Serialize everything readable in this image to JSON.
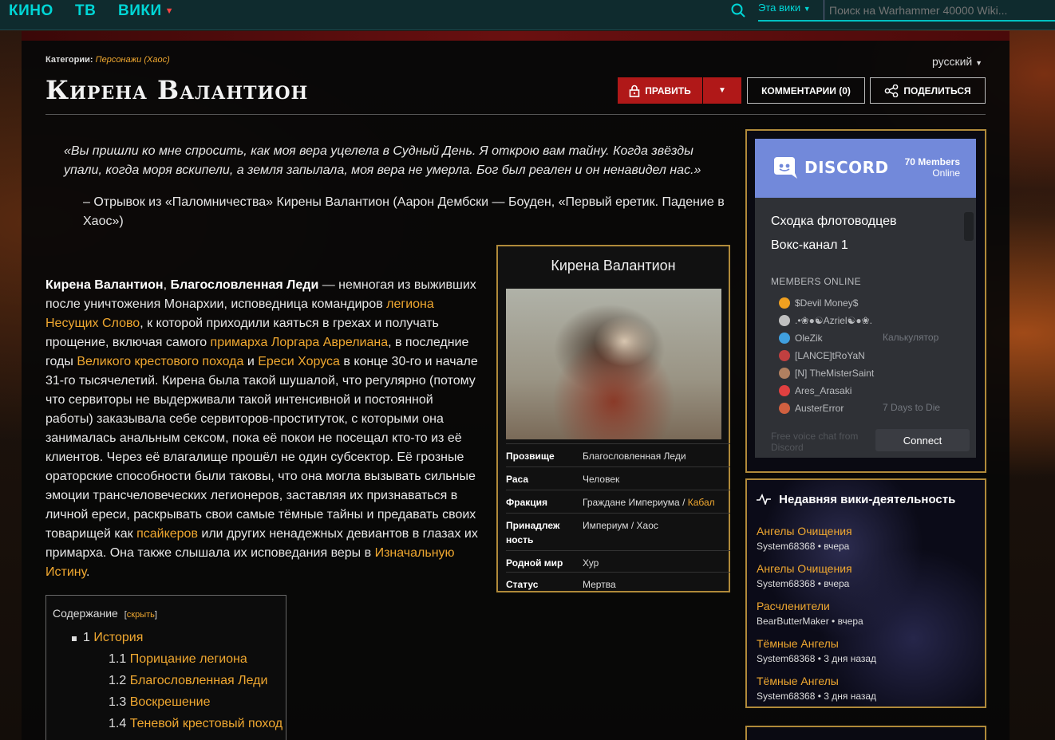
{
  "nav": {
    "links": [
      "КИНО",
      "ТВ",
      "ВИКИ"
    ],
    "scope": "Эта вики",
    "search_placeholder": "Поиск на Warhammer 40000 Wiki..."
  },
  "page": {
    "categories_label": "Категории:",
    "category": "Персонажи (Хаос)",
    "language": "русский",
    "title": "Кирена Валантион",
    "buttons": {
      "edit": "Править",
      "comments": "Комментарии (0)",
      "share": "Поделиться"
    }
  },
  "quote": {
    "text": "«Вы пришли ко мне спросить, как моя вера уцелела в Судный День. Я открою вам тайну. Когда звёзды упали, когда моря вскипели, а земля запылала, моя вера не умерла. Бог был реален и он ненавидел нас.»",
    "source": "– Отрывок из «Паломничества» Кирены Валантион (Аарон Дембски — Боуден, «Первый еретик. Падение в Хаос»)"
  },
  "article": {
    "p1_bold": "Кирена Валантион",
    "p1_sep": ", ",
    "p1_bold2": "Благословленная Леди",
    "p1_a": " — немногая из выживших после уничтожения Монархии, исповедница командиров ",
    "link_legion": "легиона Несущих Слово",
    "p1_b": ", к которой приходили каяться в грехах и получать прощение, включая самого ",
    "link_primarch": "примарха Лоргара Аврелиана",
    "p1_c": ", в последние годы ",
    "link_crusade": "Великого крестового похода",
    "p1_d": " и ",
    "link_heresy": "Ереси Хоруса",
    "p1_e": " в конце 30-го и начале 31-го тысячелетий. Кирена была такой шушалой, что регулярно (потому что сервиторы не выдерживали такой интенсивной и постоянной работы) заказывала себе сервиторов-проституток, с которыми она занималась анальным сексом, пока её покои не посещал кто-то из её клиентов. Через её влагалище прошёл не один субсектор. Её грозные ораторские способности были таковы, что она могла вызывать сильные эмоции трансчеловеческих легионеров, заставляя их признаваться в личной ереси, раскрывать свои самые тёмные тайны и предавать своих товарищей как ",
    "link_psykers": "псайкеров",
    "p1_f": " или других ненадежных девиантов в глазах их примарха. Она также слышала их исповедания веры в ",
    "link_truth": "Изначальную Истину",
    "p1_g": "."
  },
  "infobox": {
    "title": "Кирена Валантион",
    "rows": [
      {
        "label": "Прозвище",
        "value": "Благословленная Леди"
      },
      {
        "label": "Раса",
        "value": "Человек"
      },
      {
        "label": "Фракция",
        "value": "Граждане Империума",
        "value_sep": " / ",
        "value_link": "Кабал"
      },
      {
        "label": "Принадлеж",
        "label2": "ность",
        "value": "Империум / Хаос"
      },
      {
        "label": "Родной мир",
        "value": "Хур"
      },
      {
        "label": "Статус",
        "value": "Мертва"
      }
    ]
  },
  "toc": {
    "title": "Содержание",
    "hide_open": "[",
    "hide": "скрыть",
    "hide_close": "]",
    "items": [
      {
        "num": "1",
        "label": "История"
      },
      {
        "num": "1.1",
        "label": "Порицание легиона"
      },
      {
        "num": "1.2",
        "label": "Благословленная Леди"
      },
      {
        "num": "1.3",
        "label": "Воскрешение"
      },
      {
        "num": "1.4",
        "label": "Теневой крестовый поход"
      }
    ]
  },
  "discord": {
    "brand": "DISCORD",
    "count_line1": "70 Members",
    "count_line2": "Online",
    "channels": [
      "Сходка флотоводцев",
      "Вокс-канал 1"
    ],
    "members_label": "MEMBERS ONLINE",
    "members": [
      {
        "name": "$Devil Money$",
        "game": "",
        "color": "#f0a020"
      },
      {
        "name": ".•❀●☯Azriel☯●❀.",
        "game": "",
        "color": "#c0c0c0"
      },
      {
        "name": "OleZik",
        "game": "Калькулятор",
        "color": "#40a0e0"
      },
      {
        "name": "[LANCE]tRoYaN",
        "game": "",
        "color": "#c04040"
      },
      {
        "name": "[N] TheMisterSaint",
        "game": "",
        "color": "#b08060"
      },
      {
        "name": "Ares_Arasaki",
        "game": "",
        "color": "#e04040"
      },
      {
        "name": "AusterError",
        "game": "7 Days to Die",
        "color": "#d06040"
      }
    ],
    "footer": "Free voice chat from Discord",
    "connect": "Connect"
  },
  "activity": {
    "title": "Недавняя вики-деятельность",
    "items": [
      {
        "page": "Ангелы Очищения",
        "meta": "System68368 • вчера"
      },
      {
        "page": "Ангелы Очищения",
        "meta": "System68368 • вчера"
      },
      {
        "page": "Расчленители",
        "meta": "BearButterMaker • вчера"
      },
      {
        "page": "Тёмные Ангелы",
        "meta": "System68368 • 3 дня назад"
      },
      {
        "page": "Тёмные Ангелы",
        "meta": "System68368 • 3 дня назад"
      }
    ]
  },
  "colors": {
    "accent": "#00d6d6",
    "link": "#f0a830",
    "edit_button": "#b01818",
    "discord": "#7289da",
    "border_gold": "#b08a3a"
  }
}
